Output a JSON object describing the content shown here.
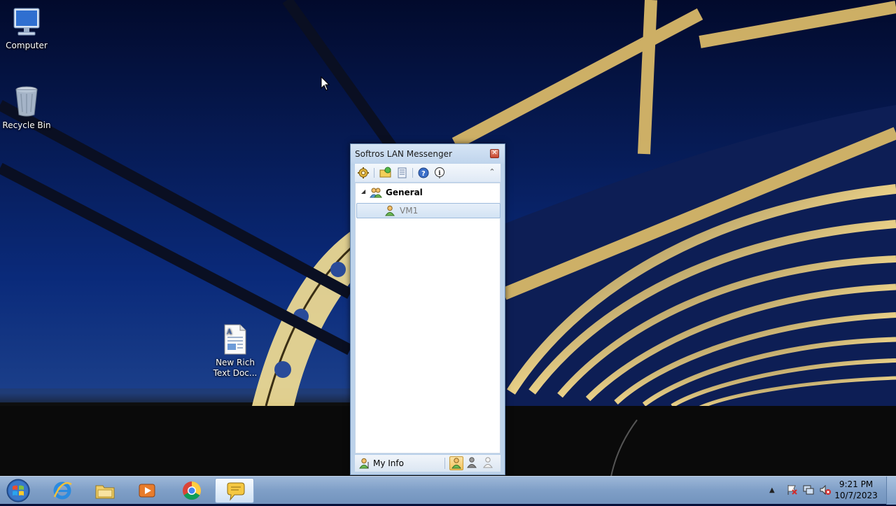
{
  "desktop": {
    "icons": [
      {
        "label": "Computer",
        "icon": "computer-icon"
      },
      {
        "label": "Recycle Bin",
        "icon": "recycle-bin-icon"
      },
      {
        "label": "New Rich Text Doc...",
        "line1": "New Rich",
        "line2": "Text Doc...",
        "icon": "rtf-document-icon"
      }
    ]
  },
  "messenger": {
    "title": "Softros LAN Messenger",
    "toolbar": [
      "settings-icon",
      "open-folder-icon",
      "message-history-icon",
      "help-icon",
      "info-icon",
      "collapse-icon"
    ],
    "group": {
      "name": "General"
    },
    "users": [
      {
        "name": "VM1"
      }
    ],
    "status": {
      "my_info_label": "My Info",
      "modes": [
        "online-status-icon",
        "away-status-icon",
        "offline-status-icon"
      ],
      "active_mode": "online-status-icon"
    }
  },
  "taskbar": {
    "apps": [
      "internet-explorer-icon",
      "file-explorer-icon",
      "media-player-icon",
      "chrome-icon",
      "softros-messenger-icon"
    ],
    "active_app": "softros-messenger-icon",
    "tray_icons": [
      "show-hidden-icons-arrow",
      "action-center-flag-icon",
      "network-icon",
      "volume-muted-icon"
    ],
    "clock": {
      "time": "9:21 PM",
      "date": "10/7/2023"
    }
  },
  "colors": {
    "taskbar": "#7f9fc7",
    "window_frame": "#bcd2ea",
    "selection": "#d3e3f4",
    "active_status": "#f3c35c"
  }
}
